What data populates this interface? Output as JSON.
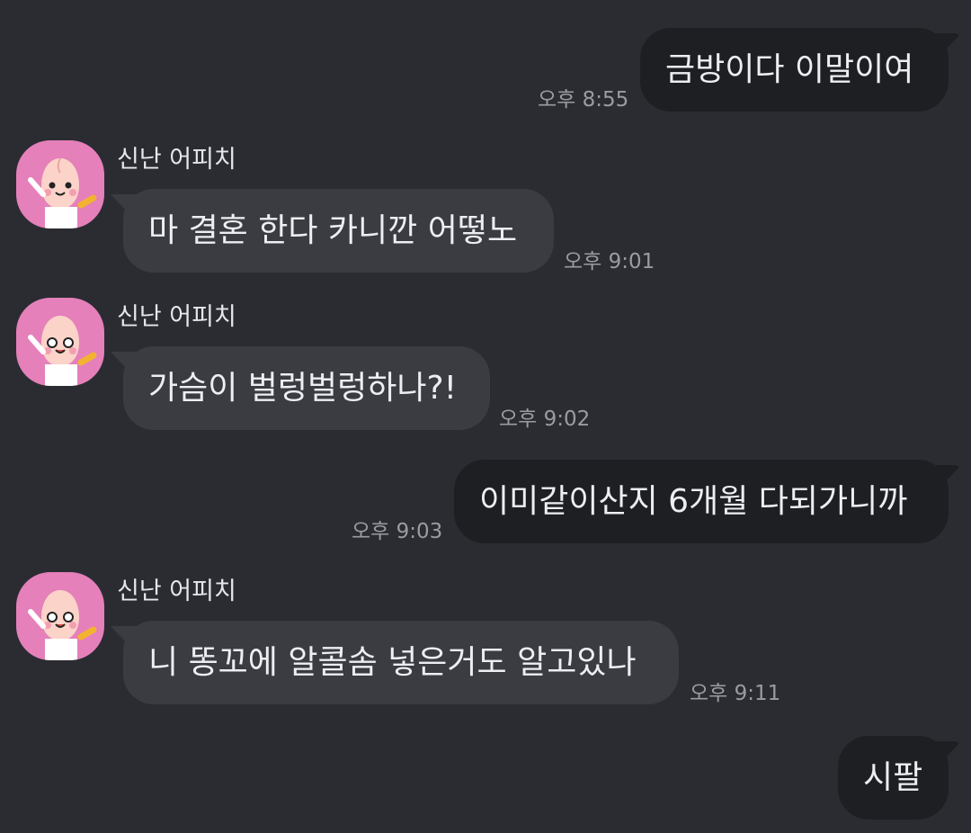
{
  "messages": [
    {
      "side": "mine",
      "text": "금방이다 이말이여",
      "time": "오후 8:55"
    },
    {
      "side": "theirs",
      "sender": "신난 어피치",
      "avatar": "apeach-avatar",
      "text": "마 결혼 한다 카니깐 어떻노",
      "time": "오후 9:01"
    },
    {
      "side": "theirs",
      "sender": "신난 어피치",
      "avatar": "apeach-avatar",
      "text": "가슴이 벌렁벌렁하나?!",
      "time": "오후 9:02"
    },
    {
      "side": "mine",
      "text": "이미같이산지 6개월 다되가니까",
      "time": "오후 9:03"
    },
    {
      "side": "theirs",
      "sender": "신난 어피치",
      "avatar": "apeach-avatar",
      "text": "니 똥꼬에 알콜솜 넣은거도 알고있나",
      "time": "오후 9:11"
    },
    {
      "side": "mine",
      "text": "시팔",
      "time": ""
    }
  ],
  "colors": {
    "background": "#2a2c31",
    "mine_bubble": "#1e1f22",
    "their_bubble": "#3a3c42",
    "avatar_bg": "#e580ba"
  }
}
